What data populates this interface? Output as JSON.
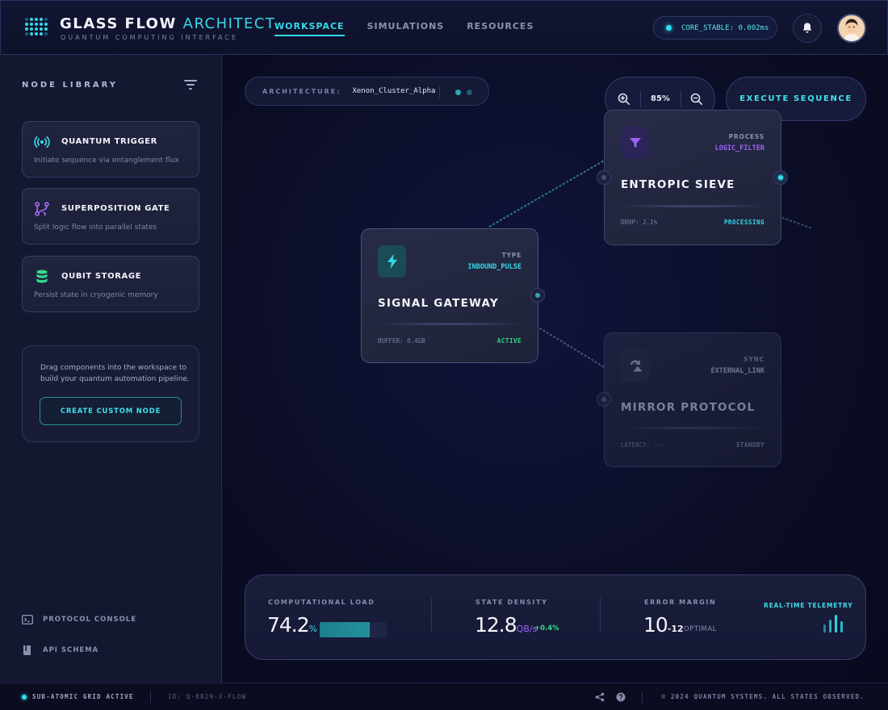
{
  "header": {
    "brand_main": "GLASS FLOW",
    "brand_accent": "ARCHITECT",
    "brand_subtitle": "QUANTUM COMPUTING INTERFACE",
    "nav": [
      {
        "label": "WORKSPACE",
        "active": true
      },
      {
        "label": "SIMULATIONS",
        "active": false
      },
      {
        "label": "RESOURCES",
        "active": false
      }
    ],
    "status": "CORE_STABLE: 0.002ms"
  },
  "sidebar": {
    "title": "NODE LIBRARY",
    "nodes": [
      {
        "name": "QUANTUM TRIGGER",
        "description": "Initiate sequence via entanglement flux",
        "icon": "broadcast-icon"
      },
      {
        "name": "SUPERPOSITION GATE",
        "description": "Split logic flow into parallel states",
        "icon": "branch-icon"
      },
      {
        "name": "QUBIT STORAGE",
        "description": "Persist state in cryogenic memory",
        "icon": "database-icon"
      }
    ],
    "info_text": "Drag components into the workspace to build your quantum automation pipeline.",
    "create_button": "CREATE CUSTOM NODE",
    "links": [
      {
        "label": "PROTOCOL CONSOLE",
        "icon": "terminal-icon"
      },
      {
        "label": "API SCHEMA",
        "icon": "book-icon"
      }
    ]
  },
  "workspace": {
    "architecture_label": "ARCHITECTURE:",
    "architecture_value": "Xenon_Cluster_Alpha",
    "zoom": "85%",
    "execute_button": "EXECUTE SEQUENCE",
    "nodes": {
      "signal": {
        "type_key": "TYPE",
        "type_value": "INBOUND_PULSE",
        "title": "SIGNAL GATEWAY",
        "stat": "BUFFER: 0.4GB",
        "state": "ACTIVE",
        "icon": "lightning-icon"
      },
      "sieve": {
        "type_key": "PROCESS",
        "type_value": "LOGIC_FILTER",
        "title": "ENTROPIC SIEVE",
        "stat": "DROP: 2.1%",
        "state": "PROCESSING",
        "icon": "filter-icon"
      },
      "mirror": {
        "type_key": "SYNC",
        "type_value": "EXTERNAL_LINK",
        "title": "MIRROR PROTOCOL",
        "stat": "LATENCY: ---",
        "state": "STANDBY",
        "icon": "sync-icon"
      }
    }
  },
  "telemetry": {
    "load_label": "COMPUTATIONAL LOAD",
    "load_value": "74.2",
    "load_unit": "%",
    "load_fraction": 0.742,
    "density_label": "STATE DENSITY",
    "density_value": "12.8",
    "density_unit": "QB/s",
    "density_delta": "+0.4%",
    "error_label": "ERROR MARGIN",
    "error_base": "10",
    "error_exp": "-12",
    "error_status": "OPTIMAL",
    "realtime_label": "REAL-TIME TELEMETRY"
  },
  "footer": {
    "grid_status": "SUB-ATOMIC GRID ACTIVE",
    "id": "ID: Q-8829-X-FLOW",
    "copyright": "© 2024 QUANTUM SYSTEMS. ALL STATES OBSERVED."
  },
  "colors": {
    "accent_cyan": "#35d8e8",
    "accent_purple": "#8b5cf6",
    "accent_green": "#39d98a",
    "background": "#0a0b1c"
  }
}
